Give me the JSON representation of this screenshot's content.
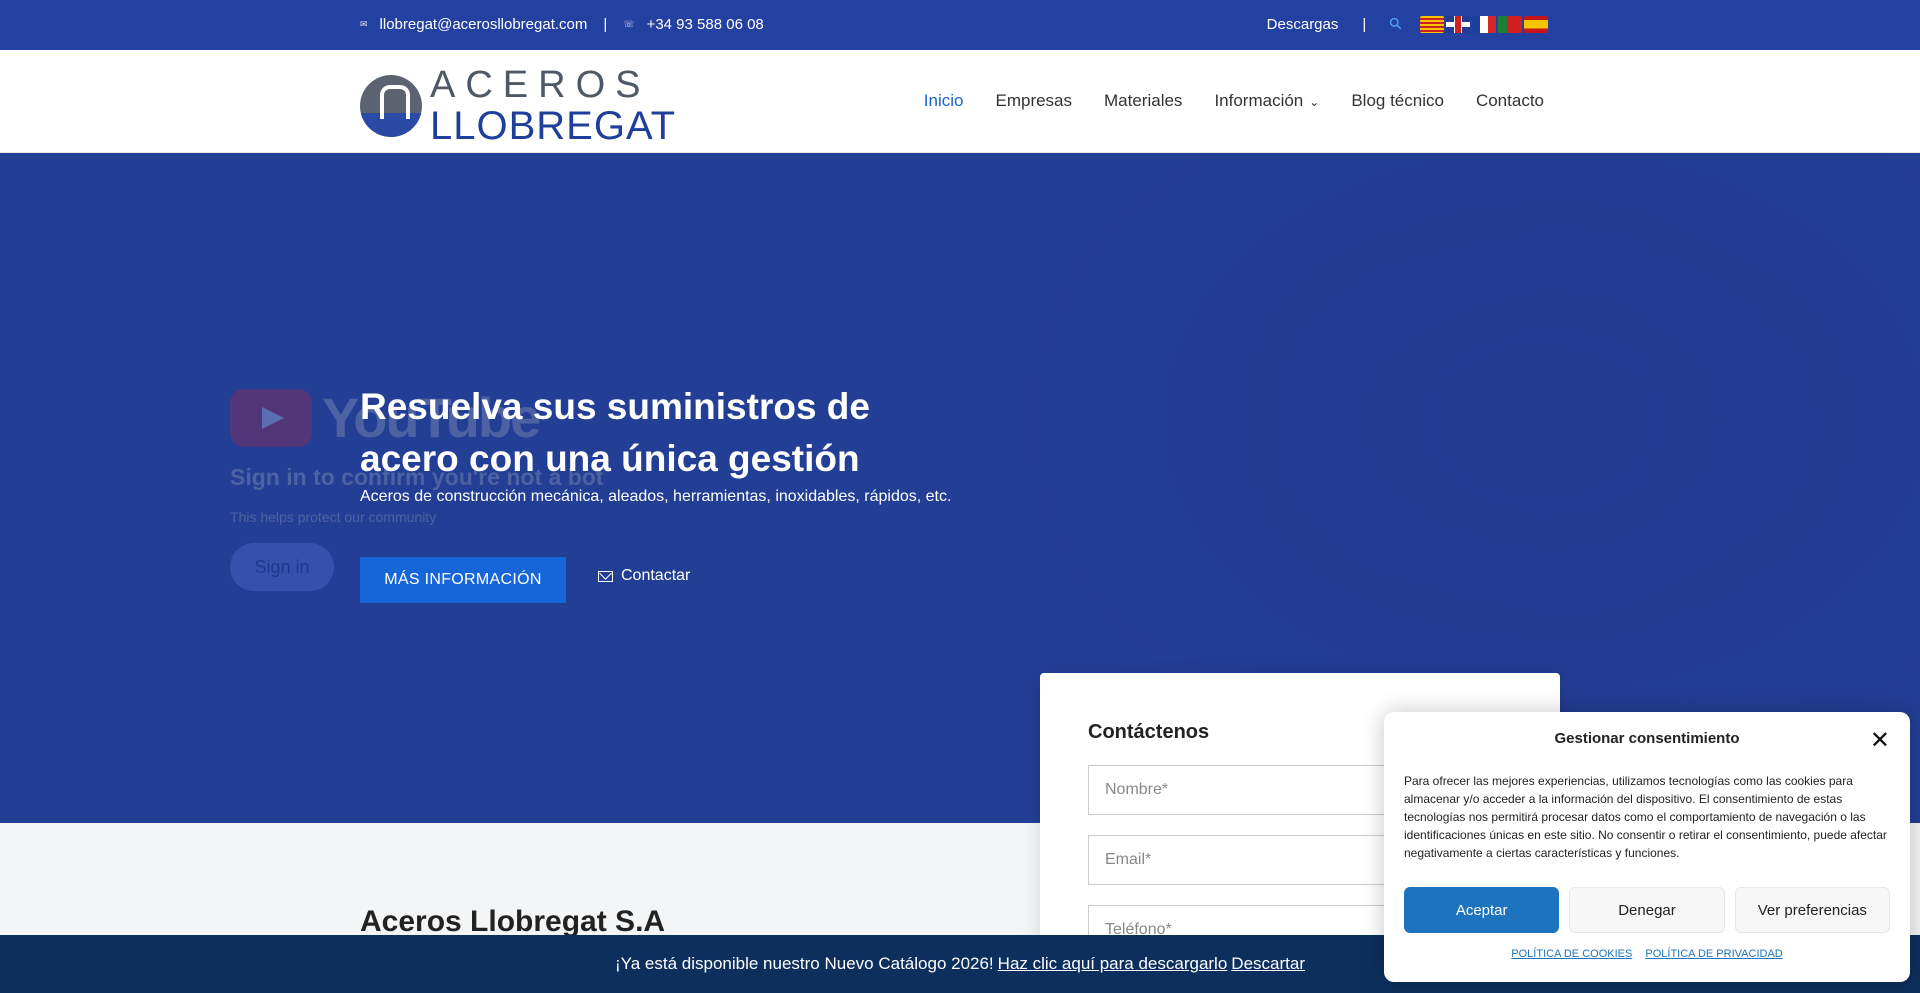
{
  "topbar": {
    "email": "llobregat@acerosllobregat.com",
    "separator": "|",
    "phone": "+34 93 588 06 08",
    "downloads": "Descargas",
    "right_separator": "|",
    "flags": [
      "Català",
      "English",
      "Français",
      "Português",
      "Español"
    ]
  },
  "header": {
    "logo_line1": "ACEROS",
    "logo_line2": "LLOBREGAT",
    "nav": [
      {
        "label": "Inicio",
        "active": true
      },
      {
        "label": "Empresas"
      },
      {
        "label": "Materiales"
      },
      {
        "label": "Información",
        "has_dropdown": true
      },
      {
        "label": "Blog técnico"
      },
      {
        "label": "Contacto"
      }
    ]
  },
  "youtube_overlay": {
    "word": "YouTube",
    "heading": "Sign in to confirm you're not a bot",
    "subtext": "This helps protect our community",
    "signin": "Sign in"
  },
  "hero": {
    "title_line1": "Resuelva sus suministros de",
    "title_line2": "acero con una única gestión",
    "subtitle": "Aceros de construcción mecánica, aleados, herramientas, inoxidables, rápidos, etc.",
    "cta_primary": "MÁS INFORMACIÓN",
    "cta_secondary": "Contactar"
  },
  "section": {
    "title": "Aceros Llobregat S.A"
  },
  "contact_form": {
    "title": "Contáctenos",
    "name_placeholder": "Nombre*",
    "email_placeholder": "Email*",
    "phone_placeholder": "Teléfono*"
  },
  "catalog_bar": {
    "text": "¡Ya está disponible nuestro Nuevo Catálogo 2026!",
    "link": "Haz clic aquí para descargarlo",
    "dismiss": "Descartar"
  },
  "consent": {
    "title": "Gestionar consentimiento",
    "body": "Para ofrecer las mejores experiencias, utilizamos tecnologías como las cookies para almacenar y/o acceder a la información del dispositivo. El consentimiento de estas tecnologías nos permitirá procesar datos como el comportamiento de navegación o las identificaciones únicas en este sitio. No consentir o retirar el consentimiento, puede afectar negativamente a ciertas características y funciones.",
    "accept": "Aceptar",
    "deny": "Denegar",
    "preferences": "Ver preferencias",
    "cookie_policy": "POLÍTICA DE COOKIES",
    "privacy_policy": "POLÍTICA DE PRIVACIDAD"
  },
  "colors": {
    "topbar": "#2341a0",
    "hero": "#233e95",
    "accent": "#1766d9",
    "catalog_bar": "#0c2f5d",
    "consent_accept": "#1e73be"
  }
}
